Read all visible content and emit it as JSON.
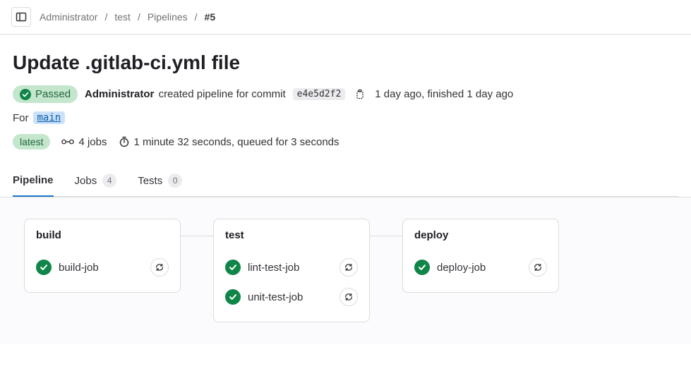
{
  "breadcrumbs": {
    "items": [
      "Administrator",
      "test",
      "Pipelines"
    ],
    "current": "#5"
  },
  "title": "Update .gitlab-ci.yml file",
  "status": {
    "label": "Passed"
  },
  "author": "Administrator",
  "created_text": "created pipeline for commit",
  "commit": "e4e5d2f2",
  "time_text": "1 day ago, finished 1 day ago",
  "for_text": "For",
  "branch": "main",
  "latest_label": "latest",
  "jobs_count": "4 jobs",
  "duration_text": "1 minute 32 seconds, queued for 3 seconds",
  "tabs": {
    "pipeline": "Pipeline",
    "jobs": "Jobs",
    "jobs_badge": "4",
    "tests": "Tests",
    "tests_badge": "0"
  },
  "stages": [
    {
      "name": "build",
      "jobs": [
        {
          "name": "build-job"
        }
      ]
    },
    {
      "name": "test",
      "jobs": [
        {
          "name": "lint-test-job"
        },
        {
          "name": "unit-test-job"
        }
      ]
    },
    {
      "name": "deploy",
      "jobs": [
        {
          "name": "deploy-job"
        }
      ]
    }
  ]
}
